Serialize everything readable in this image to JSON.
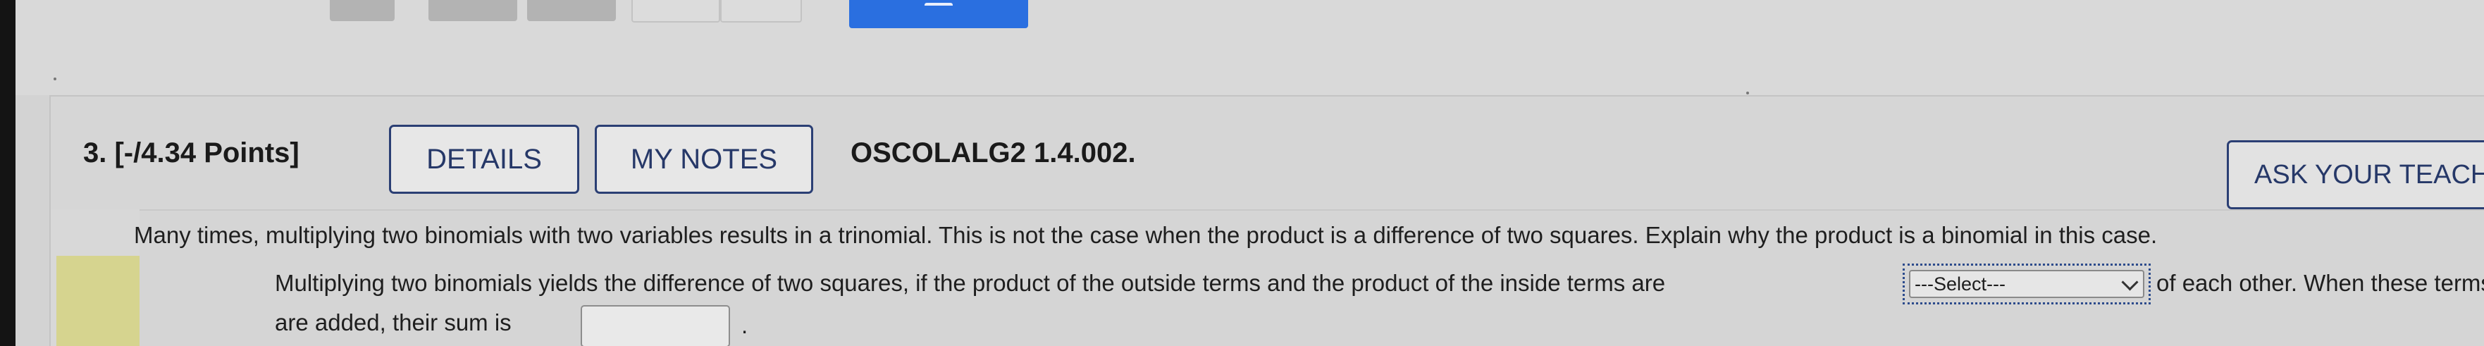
{
  "question": {
    "number_points": "3. [-/4.34 Points]",
    "details_label": "DETAILS",
    "my_notes_label": "MY NOTES",
    "code": "OSCOLALG2 1.4.002.",
    "ask_label": "ASK YOUR TEACHER"
  },
  "body": {
    "paragraph": "Many times, multiplying two binomials with two variables results in a trinomial. This is not the case when the product is a difference of two squares. Explain why the product is a binomial in this case.",
    "line2_start": "Multiplying two binomials yields the difference of two squares, if the product of the outside terms and the product of the inside terms are",
    "select_value": "---Select---",
    "line2_end": "of each other. When these terms",
    "line3_start": "are added, their sum is",
    "line3_end": "."
  }
}
